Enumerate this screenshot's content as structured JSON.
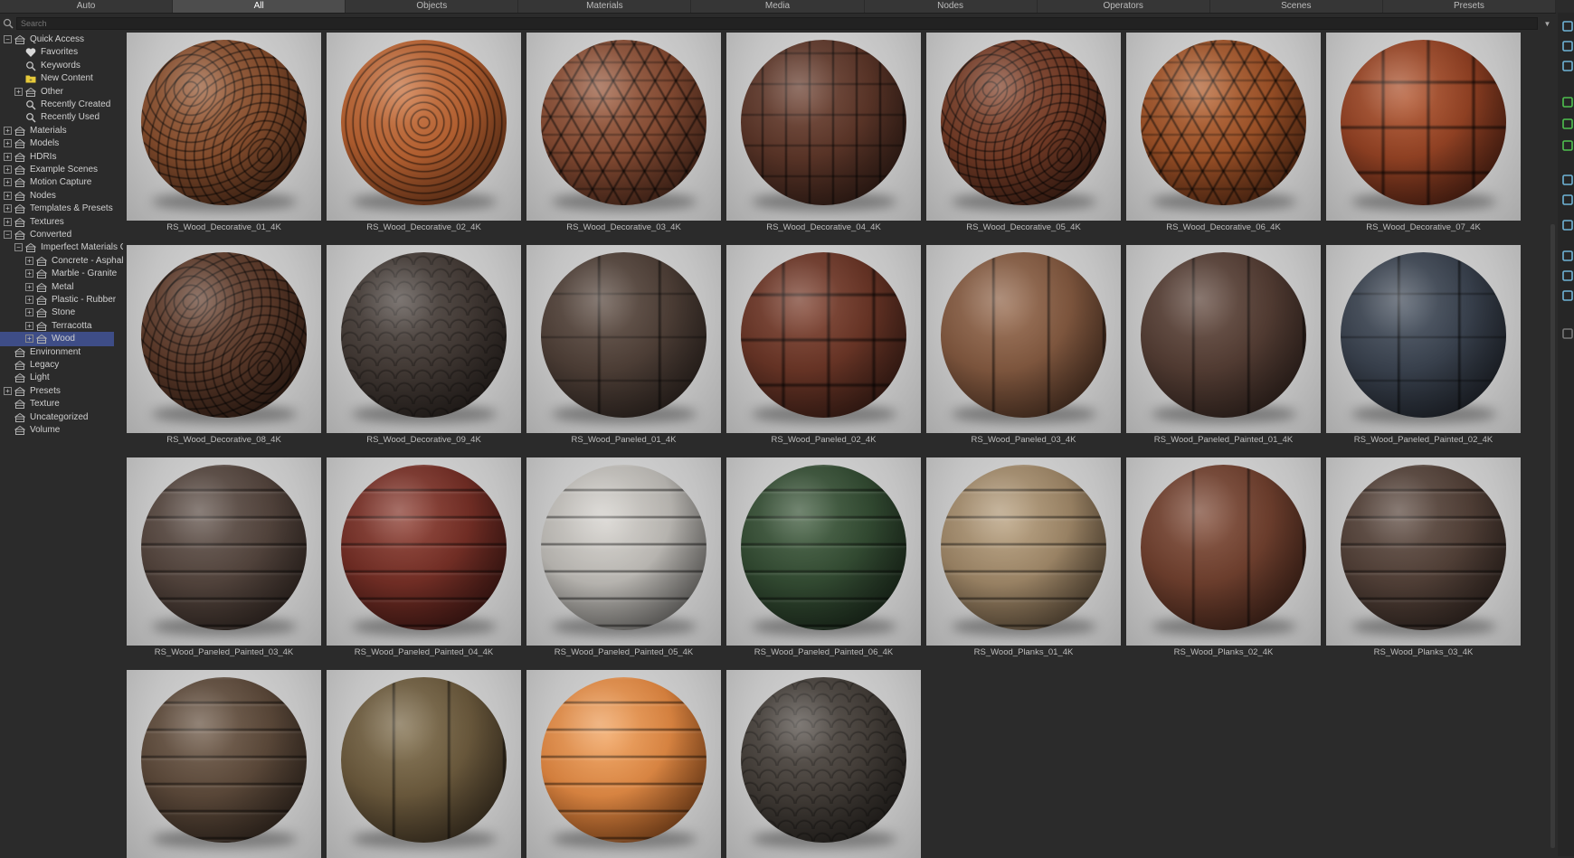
{
  "tabs": [
    {
      "label": "Auto",
      "active": false
    },
    {
      "label": "All",
      "active": true
    },
    {
      "label": "Objects",
      "active": false
    },
    {
      "label": "Materials",
      "active": false
    },
    {
      "label": "Media",
      "active": false
    },
    {
      "label": "Nodes",
      "active": false
    },
    {
      "label": "Operators",
      "active": false
    },
    {
      "label": "Scenes",
      "active": false
    },
    {
      "label": "Presets",
      "active": false
    }
  ],
  "search": {
    "placeholder": "Search",
    "value": ""
  },
  "tree": [
    {
      "label": "Quick Access",
      "level": 0,
      "expander": "minus",
      "icon": "library-icon"
    },
    {
      "label": "Favorites",
      "level": 1,
      "expander": "none",
      "icon": "heart-icon"
    },
    {
      "label": "Keywords",
      "level": 1,
      "expander": "none",
      "icon": "search-icon"
    },
    {
      "label": "New Content",
      "level": 1,
      "expander": "none",
      "icon": "new-folder-icon"
    },
    {
      "label": "Other",
      "level": 1,
      "expander": "plus",
      "icon": "library-icon"
    },
    {
      "label": "Recently Created",
      "level": 1,
      "expander": "none",
      "icon": "search-icon"
    },
    {
      "label": "Recently Used",
      "level": 1,
      "expander": "none",
      "icon": "search-icon"
    },
    {
      "label": "Materials",
      "level": 0,
      "expander": "plus",
      "icon": "library-icon"
    },
    {
      "label": "Models",
      "level": 0,
      "expander": "plus",
      "icon": "library-icon"
    },
    {
      "label": "HDRIs",
      "level": 0,
      "expander": "plus",
      "icon": "library-icon"
    },
    {
      "label": "Example Scenes",
      "level": 0,
      "expander": "plus",
      "icon": "library-icon"
    },
    {
      "label": "Motion Capture",
      "level": 0,
      "expander": "plus",
      "icon": "library-icon"
    },
    {
      "label": "Nodes",
      "level": 0,
      "expander": "plus",
      "icon": "library-icon"
    },
    {
      "label": "Templates & Presets",
      "level": 0,
      "expander": "plus",
      "icon": "library-icon"
    },
    {
      "label": "Textures",
      "level": 0,
      "expander": "plus",
      "icon": "library-icon"
    },
    {
      "label": "Converted",
      "level": 0,
      "expander": "minus",
      "icon": "library-icon"
    },
    {
      "label": "Imperfect Materials C",
      "level": 1,
      "expander": "minus",
      "icon": "library-icon"
    },
    {
      "label": "Concrete - Asphal",
      "level": 2,
      "expander": "plus",
      "icon": "library-icon"
    },
    {
      "label": "Marble - Granite",
      "level": 2,
      "expander": "plus",
      "icon": "library-icon"
    },
    {
      "label": "Metal",
      "level": 2,
      "expander": "plus",
      "icon": "library-icon"
    },
    {
      "label": "Plastic - Rubber",
      "level": 2,
      "expander": "plus",
      "icon": "library-icon"
    },
    {
      "label": "Stone",
      "level": 2,
      "expander": "plus",
      "icon": "library-icon"
    },
    {
      "label": "Terracotta",
      "level": 2,
      "expander": "plus",
      "icon": "library-icon"
    },
    {
      "label": "Wood",
      "level": 2,
      "expander": "plus",
      "icon": "library-icon",
      "selected": true
    },
    {
      "label": "Environment",
      "level": 0,
      "expander": "none",
      "icon": "library-icon"
    },
    {
      "label": "Legacy",
      "level": 0,
      "expander": "none",
      "icon": "library-icon"
    },
    {
      "label": "Light",
      "level": 0,
      "expander": "none",
      "icon": "library-icon"
    },
    {
      "label": "Presets",
      "level": 0,
      "expander": "plus",
      "icon": "library-icon"
    },
    {
      "label": "Texture",
      "level": 0,
      "expander": "none",
      "icon": "library-icon"
    },
    {
      "label": "Uncategorized",
      "level": 0,
      "expander": "none",
      "icon": "library-icon"
    },
    {
      "label": "Volume",
      "level": 0,
      "expander": "none",
      "icon": "library-icon"
    }
  ],
  "materials": [
    {
      "name": "RS_Wood_Decorative_01_4K",
      "base": "#5a321d",
      "highlight": "#9b5b35",
      "pattern": "swirls"
    },
    {
      "name": "RS_Wood_Decorative_02_4K",
      "base": "#8a431f",
      "highlight": "#c86f3a",
      "pattern": "spirals"
    },
    {
      "name": "RS_Wood_Decorative_03_4K",
      "base": "#5c3020",
      "highlight": "#9a5a3d",
      "pattern": "stars"
    },
    {
      "name": "RS_Wood_Decorative_04_4K",
      "base": "#3b221a",
      "highlight": "#6b3f2f",
      "pattern": "weave"
    },
    {
      "name": "RS_Wood_Decorative_05_4K",
      "base": "#4a2518",
      "highlight": "#86452c",
      "pattern": "swirls"
    },
    {
      "name": "RS_Wood_Decorative_06_4K",
      "base": "#6e3418",
      "highlight": "#b2602f",
      "pattern": "stars"
    },
    {
      "name": "RS_Wood_Decorative_07_4K",
      "base": "#5c2415",
      "highlight": "#b0532c",
      "pattern": "grid"
    },
    {
      "name": "RS_Wood_Decorative_08_4K",
      "base": "#3e2519",
      "highlight": "#6a4432",
      "pattern": "swirls"
    },
    {
      "name": "RS_Wood_Decorative_09_4K",
      "base": "#2e2622",
      "highlight": "#4e4540",
      "pattern": "scales"
    },
    {
      "name": "RS_Wood_Paneled_01_4K",
      "base": "#352a25",
      "highlight": "#5b4a40",
      "pattern": "panels"
    },
    {
      "name": "RS_Wood_Paneled_02_4K",
      "base": "#46231a",
      "highlight": "#7b3e2c",
      "pattern": "cross"
    },
    {
      "name": "RS_Wood_Paneled_03_4K",
      "base": "#5b3a28",
      "highlight": "#94684c",
      "pattern": "vertical"
    },
    {
      "name": "RS_Wood_Paneled_Painted_01_4K",
      "base": "#3b2a24",
      "highlight": "#5f463b",
      "pattern": "vertical"
    },
    {
      "name": "RS_Wood_Paneled_Painted_02_4K",
      "base": "#232831",
      "highlight": "#46505e",
      "pattern": "panels"
    },
    {
      "name": "RS_Wood_Paneled_Painted_03_4K",
      "base": "#3b2e28",
      "highlight": "#5f5048",
      "pattern": "planks"
    },
    {
      "name": "RS_Wood_Paneled_Painted_04_4K",
      "base": "#4a1a16",
      "highlight": "#8a3a2e",
      "pattern": "planks"
    },
    {
      "name": "RS_Wood_Paneled_Painted_05_4K",
      "base": "#8c8a86",
      "highlight": "#d3d0cb",
      "pattern": "planks"
    },
    {
      "name": "RS_Wood_Paneled_Painted_06_4K",
      "base": "#1f3020",
      "highlight": "#3e5a3c",
      "pattern": "planks"
    },
    {
      "name": "RS_Wood_Planks_01_4K",
      "base": "#6f5a42",
      "highlight": "#b59d7b",
      "pattern": "planks"
    },
    {
      "name": "RS_Wood_Planks_02_4K",
      "base": "#4e2a1e",
      "highlight": "#7e4a36",
      "pattern": "vertical"
    },
    {
      "name": "RS_Wood_Planks_03_4K",
      "base": "#3a2c26",
      "highlight": "#5d4a40",
      "pattern": "planks"
    },
    {
      "name": "",
      "base": "#3e3026",
      "highlight": "#6b5644",
      "pattern": "planks"
    },
    {
      "name": "",
      "base": "#4a3b28",
      "highlight": "#7c6a48",
      "pattern": "vertical"
    },
    {
      "name": "",
      "base": "#b25a1e",
      "highlight": "#f0a05a",
      "pattern": "planks"
    },
    {
      "name": "",
      "base": "#2c2824",
      "highlight": "#514a44",
      "pattern": "scales"
    }
  ],
  "colors": {
    "background": "#2b2b2b",
    "tabActive": "#4d4d4d",
    "selection": "#3e4d87",
    "text": "#cfcfcf"
  },
  "right_toolbar_icons": [
    "cube-icon",
    "box-icon",
    "text-icon",
    "sun-icon",
    "tree-icon",
    "gear-icon",
    "pen-icon",
    "frame-icon",
    "link-icon",
    "ring-icon",
    "camera-icon",
    "monitor-icon",
    "circle-icon"
  ]
}
